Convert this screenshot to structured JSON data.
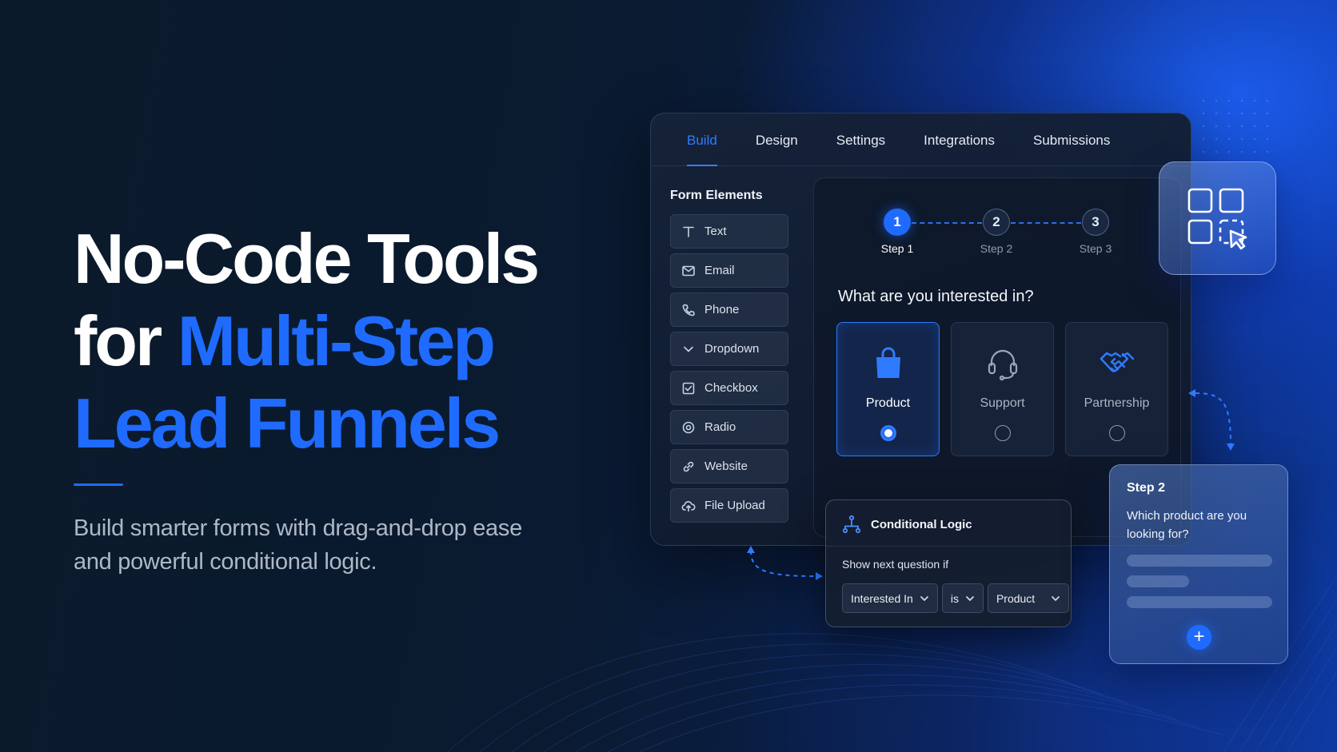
{
  "hero": {
    "title_line1": "No-Code Tools",
    "title_line2_plain": "for ",
    "title_line2_accent": "Multi-Step",
    "title_line3_accent": "Lead Funnels",
    "subtitle": "Build smarter forms with drag-and-drop ease and powerful conditional logic."
  },
  "tabs": [
    {
      "label": "Build",
      "active": true
    },
    {
      "label": "Design"
    },
    {
      "label": "Settings"
    },
    {
      "label": "Integrations"
    },
    {
      "label": "Submissions"
    }
  ],
  "form_elements": {
    "title": "Form Elements",
    "items": [
      {
        "label": "Text",
        "icon": "text-icon"
      },
      {
        "label": "Email",
        "icon": "email-icon"
      },
      {
        "label": "Phone",
        "icon": "phone-icon"
      },
      {
        "label": "Dropdown",
        "icon": "chevron-down-icon"
      },
      {
        "label": "Checkbox",
        "icon": "checkbox-icon"
      },
      {
        "label": "Radio",
        "icon": "radio-icon"
      },
      {
        "label": "Website",
        "icon": "link-icon"
      },
      {
        "label": "File Upload",
        "icon": "cloud-upload-icon"
      }
    ]
  },
  "stepper": {
    "steps": [
      {
        "number": "1",
        "label": "Step 1",
        "active": true
      },
      {
        "number": "2",
        "label": "Step 2"
      },
      {
        "number": "3",
        "label": "Step 3"
      }
    ]
  },
  "question": "What are you interested in?",
  "options": [
    {
      "label": "Product",
      "icon": "shopping-bag-icon",
      "selected": true
    },
    {
      "label": "Support",
      "icon": "headset-icon"
    },
    {
      "label": "Partnership",
      "icon": "handshake-icon"
    }
  ],
  "logic": {
    "title": "Conditional Logic",
    "description": "Show next question if",
    "field": "Interested In",
    "operator": "is",
    "value": "Product"
  },
  "next_step": {
    "title": "Step 2",
    "question": "Which product are you looking for?",
    "add_label": "+"
  },
  "colors": {
    "accent": "#1f6bff",
    "background": "#0b1a2a",
    "panel": "#0e182a"
  }
}
